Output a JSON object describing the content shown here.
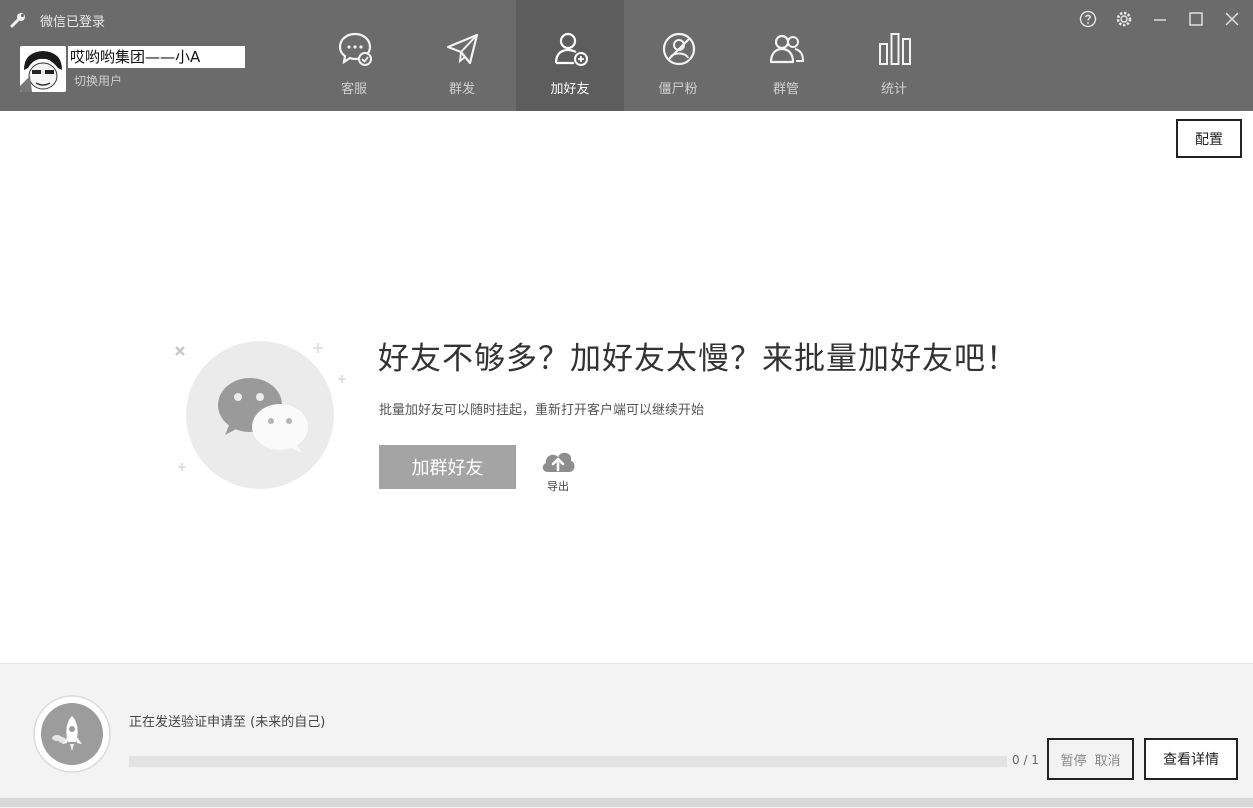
{
  "app": {
    "title": "微信已登录"
  },
  "user": {
    "name": "哎哟哟集团——小A",
    "switch_label": "切换用户"
  },
  "nav": {
    "tabs": [
      {
        "label": "客服",
        "icon": "chat-check-icon",
        "active": false
      },
      {
        "label": "群发",
        "icon": "paper-plane-icon",
        "active": false
      },
      {
        "label": "加好友",
        "icon": "add-friend-icon",
        "active": true
      },
      {
        "label": "僵尸粉",
        "icon": "zombie-fans-icon",
        "active": false
      },
      {
        "label": "群管",
        "icon": "group-manage-icon",
        "active": false
      },
      {
        "label": "统计",
        "icon": "bar-stats-icon",
        "active": false
      }
    ]
  },
  "window_controls": [
    "help-icon",
    "settings-icon",
    "minimize-icon",
    "maximize-icon",
    "close-icon"
  ],
  "toolbar": {
    "config_label": "配置"
  },
  "promo": {
    "title": "好友不够多？加好友太慢？来批量加好友吧！",
    "description": "批量加好友可以随时挂起，重新打开客户端可以继续开始",
    "add_group_button": "加群好友",
    "export_label": "导出"
  },
  "task": {
    "status_text": "正在发送验证申请至 (未来的自己)",
    "progress_done": 0,
    "progress_total": 1,
    "progress_label": "0 / 1",
    "pause_label": "暂停",
    "cancel_label": "取消",
    "view_details_label": "查看详情"
  },
  "colors": {
    "header_bg": "#6b6b6b",
    "active_tab_bg": "#5d5d5d",
    "button_gray": "#a4a4a4",
    "panel_bg": "#f3f3f3"
  }
}
